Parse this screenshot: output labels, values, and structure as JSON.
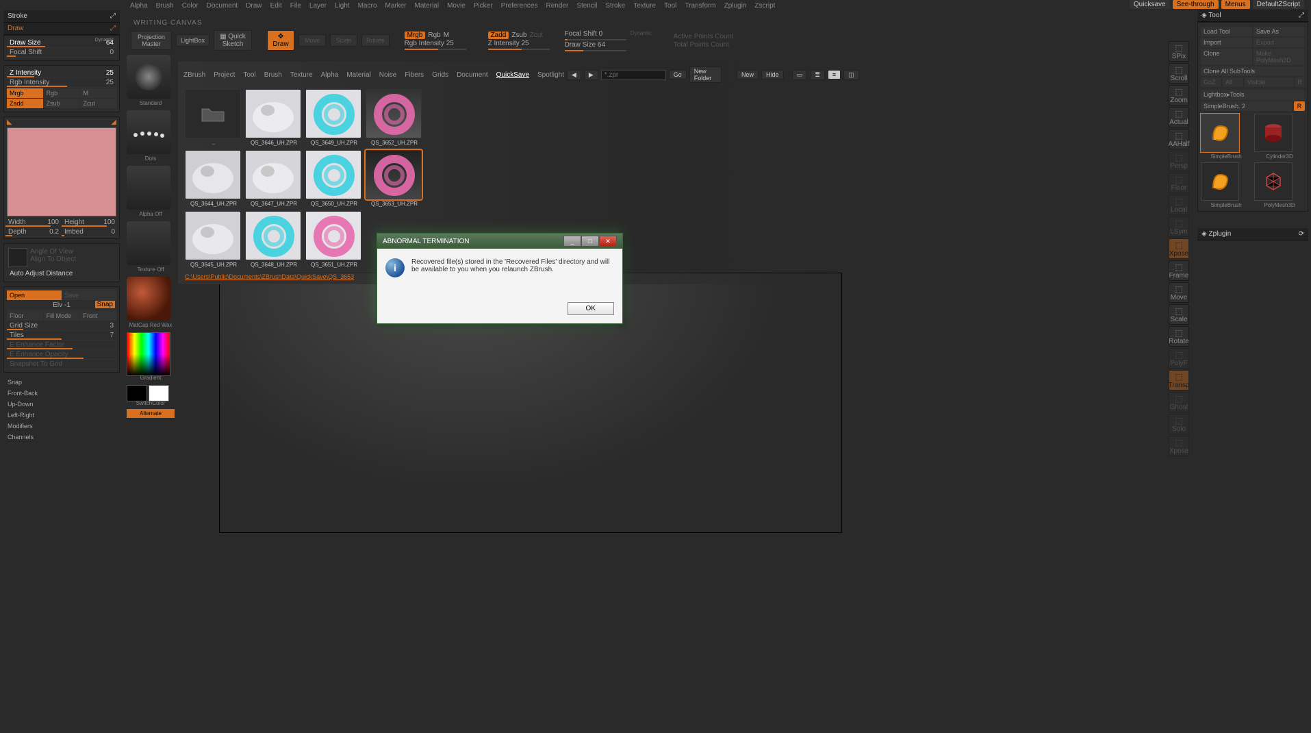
{
  "menu": [
    "Alpha",
    "Brush",
    "Color",
    "Document",
    "Draw",
    "Edit",
    "File",
    "Layer",
    "Light",
    "Macro",
    "Marker",
    "Material",
    "Movie",
    "Picker",
    "Preferences",
    "Render",
    "Stencil",
    "Stroke",
    "Texture",
    "Tool",
    "Transform",
    "Zplugin",
    "Zscript"
  ],
  "top_right": {
    "quicksave": "Quicksave",
    "see": "See-through",
    "menus": "Menus",
    "script": "DefaultZScript"
  },
  "writing": "WRITING CANVAS",
  "left": {
    "stroke": "Stroke",
    "draw": "Draw",
    "drawsize_l": "Draw Size",
    "drawsize_v": "64",
    "dynamic": "Dynamic",
    "focal_l": "Focal Shift",
    "focal_v": "0",
    "zint_l": "Z Intensity",
    "zint_v": "25",
    "rgbint_l": "Rgb Intensity",
    "rgbint_v": "25",
    "mrgb": "Mrgb",
    "rgb": "Rgb",
    "m": "M",
    "zadd": "Zadd",
    "zsub": "Zsub",
    "zcut": "Zcut",
    "width_l": "Width",
    "width_v": "100",
    "height_l": "Height",
    "height_v": "100",
    "depth_l": "Depth",
    "depth_v": "0.2",
    "imbed_l": "Imbed",
    "imbed_v": "0",
    "angle": "Angle Of View",
    "align": "Align To Object",
    "aad": "Auto Adjust Distance",
    "open": "Open",
    "save": "Save",
    "elv_l": "Elv",
    "elv_v": "-1",
    "snap": "Snap",
    "fill": "Fill Mode",
    "front": "Front",
    "floor": "Floor",
    "grid_l": "Grid Size",
    "grid_v": "3",
    "tiles_l": "Tiles",
    "tiles_v": "7",
    "efact": "E Enhance Factor",
    "eopac": "E Enhance Opacity",
    "snapg": "Snapshot To Grid",
    "menu": [
      "Snap",
      "Front-Back",
      "Up-Down",
      "Left-Right",
      "Modifiers",
      "Channels"
    ]
  },
  "brushcol": {
    "standard": "Standard",
    "dots": "Dots",
    "alphaoff": "Alpha Off",
    "texoff": "Texture Off",
    "mat": "MatCap Red Wax",
    "gradient": "Gradient",
    "switch": "SwitchColor",
    "alternate": "Alternate"
  },
  "ctrl": {
    "proj": "Projection Master",
    "lightbox": "LightBox",
    "quick": "Quick Sketch",
    "draw": "Draw",
    "move": "Move",
    "scale": "Scale",
    "rotate": "Rotate",
    "mrgb": "Mrgb",
    "rgb": "Rgb",
    "m": "M",
    "rgbint": "Rgb Intensity",
    "rgbint_v": "25",
    "zadd": "Zadd",
    "zsub": "Zsub",
    "zcut": "Zcut",
    "zint": "Z Intensity",
    "zint_v": "25",
    "focal": "Focal Shift",
    "focal_v": "0",
    "drawsize": "Draw Size",
    "drawsize_v": "64",
    "dynamic": "Dynamic",
    "active": "Active Points Count",
    "total": "Total Points Count"
  },
  "lightbox": {
    "tabs": [
      "ZBrush",
      "Project",
      "Tool",
      "Brush",
      "Texture",
      "Alpha",
      "Material",
      "Noise",
      "Fibers",
      "Grids",
      "Document",
      "QuickSave",
      "Spotlight"
    ],
    "active_tab": "QuickSave",
    "search_ph": "*.zpr",
    "go": "Go",
    "newf": "New Folder",
    "new": "New",
    "hide": "Hide",
    "path": "C:\\Users\\Public\\Documents\\ZBrushData\\QuickSave\\QS_3653",
    "items": [
      {
        "name": "..",
        "folder": true
      },
      {
        "name": "QS_3646_UH.ZPR",
        "bg": "#d8d8dc"
      },
      {
        "name": "QS_3649_UH.ZPR",
        "bg": "#e0e0e4",
        "ring": "#3bd0e0"
      },
      {
        "name": "QS_3652_UH.ZPR",
        "bg": "linear-gradient(#333,#555)",
        "ring": "#e66aac"
      },
      {
        "name": "QS_3644_UH.ZPR",
        "bg": "#cfcfd3"
      },
      {
        "name": "QS_3647_UH.ZPR",
        "bg": "#d6d6da"
      },
      {
        "name": "QS_3650_UH.ZPR",
        "bg": "#e2e2e6",
        "ring": "#3bd0e0"
      },
      {
        "name": "QS_3653_UH.ZPR",
        "bg": "linear-gradient(#222,#444)",
        "ring": "#e66aac",
        "sel": true
      },
      {
        "name": "QS_3645_UH.ZPR",
        "bg": "#d2d2d6"
      },
      {
        "name": "QS_3648_UH.ZPR",
        "bg": "#e0e0e4",
        "ring": "#3bd0e0"
      },
      {
        "name": "QS_3651_UH.ZPR",
        "bg": "#e4e4e8",
        "ring": "#e66aac"
      }
    ]
  },
  "right_tools": [
    "SPix",
    "Scroll",
    "Zoom",
    "Actual",
    "AAHalf",
    "Persp",
    "Floor",
    "Local",
    "LSym",
    "Xpose",
    "Frame",
    "Move",
    "Scale",
    "Rotate",
    "PolyF",
    "Transp",
    "Ghost",
    "Solo",
    "Xpose"
  ],
  "right": {
    "tool": "Tool",
    "load": "Load Tool",
    "saveas": "Save As",
    "import": "Import",
    "export": "Export",
    "clone": "Clone",
    "make": "Make PolyMesh3D",
    "cloneall": "Clone All SubTools",
    "goz": "GoZ",
    "all": "All",
    "visible": "Visible",
    "r": "R",
    "lbtool": "Lightbox▸Tools",
    "sbrush": "SimpleBrush. 2",
    "R": "R",
    "thumbs": [
      "SimpleBrush",
      "Cylinder3D",
      "SimpleBrush",
      "PolyMesh3D"
    ],
    "zplugin": "Zplugin"
  },
  "modal": {
    "title": "ABNORMAL TERMINATION",
    "msg": "Recovered file(s) stored in the 'Recovered Files' directory and will be available to you when you relaunch ZBrush.",
    "ok": "OK"
  }
}
